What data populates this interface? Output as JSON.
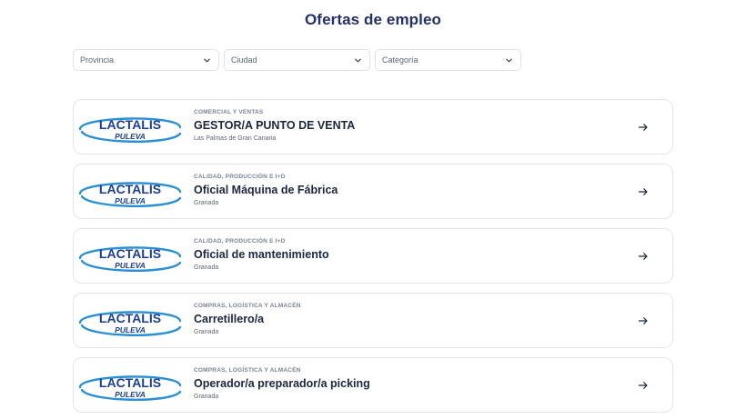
{
  "page": {
    "title": "Ofertas de empleo"
  },
  "filters": {
    "provincia": "Provincia",
    "ciudad": "Ciudad",
    "categoria": "Categoría"
  },
  "logo": {
    "line1": "LACTALIS",
    "line2": "PULEVA",
    "colors": {
      "navy": "#1b3f97",
      "blue": "#2a8fd4"
    }
  },
  "jobs": [
    {
      "category": "COMERCIAL Y VENTAS",
      "title": "GESTOR/A PUNTO DE VENTA",
      "location": "Las Palmas de Gran Canaria"
    },
    {
      "category": "CALIDAD, PRODUCCIÓN E I+D",
      "title": "Oficial Máquina de Fábrica",
      "location": "Granada"
    },
    {
      "category": "CALIDAD, PRODUCCIÓN E I+D",
      "title": "Oficial de mantenimiento",
      "location": "Granada"
    },
    {
      "category": "COMPRAS, LOGÍSTICA Y ALMACÉN",
      "title": "Carretillero/a",
      "location": "Granada"
    },
    {
      "category": "COMPRAS, LOGÍSTICA Y ALMACÉN",
      "title": "Operador/a preparador/a picking",
      "location": "Granada"
    }
  ]
}
